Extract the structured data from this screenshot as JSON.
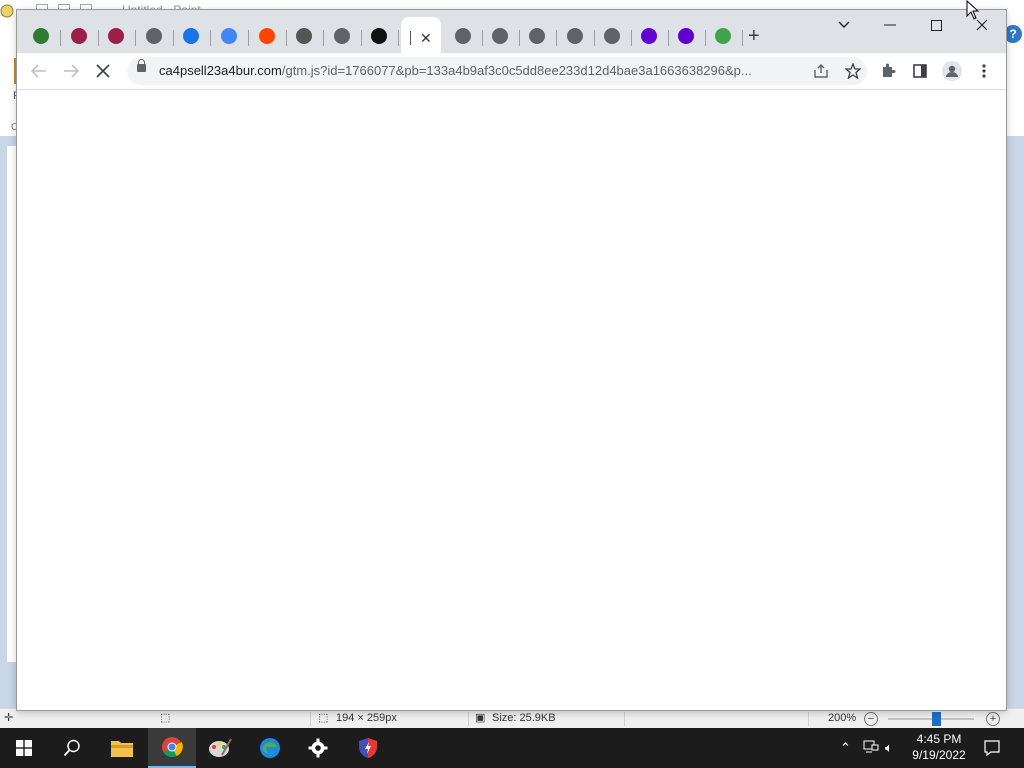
{
  "paint": {
    "title": "Untitled - Paint",
    "help_label": "?",
    "side_label_1": "P",
    "side_label_2": "C",
    "status": {
      "canvas_size": "194 × 259px",
      "file_size": "Size: 25.9KB",
      "zoom": "200%",
      "zoom_out": "−",
      "zoom_in": "+"
    }
  },
  "browser": {
    "tabs": [
      {
        "icon": "bug-icon",
        "color": "#2f7d32"
      },
      {
        "icon": "no-entry-icon",
        "color": "#9c1f49"
      },
      {
        "icon": "no-entry-icon",
        "color": "#9c1f49"
      },
      {
        "icon": "globe-icon",
        "color": "#5f6368"
      },
      {
        "icon": "bookmark-icon",
        "color": "#1a73e8"
      },
      {
        "icon": "google-icon",
        "color": "#4285f4"
      },
      {
        "icon": "reddit-icon",
        "color": "#ff4500"
      },
      {
        "icon": "airplane-icon",
        "color": "#555555"
      },
      {
        "icon": "globe-icon",
        "color": "#5f6368"
      },
      {
        "icon": "shield-icon",
        "color": "#111111"
      }
    ],
    "tabs_right": [
      {
        "icon": "globe-icon",
        "color": "#5f6368"
      },
      {
        "icon": "globe-icon",
        "color": "#5f6368"
      },
      {
        "icon": "globe-icon",
        "color": "#5f6368"
      },
      {
        "icon": "globe-icon",
        "color": "#5f6368"
      },
      {
        "icon": "globe-icon",
        "color": "#5f6368"
      },
      {
        "icon": "yahoo-icon",
        "color": "#6001d2"
      },
      {
        "icon": "yahoo-icon",
        "color": "#6001d2"
      },
      {
        "icon": "user-icon",
        "color": "#3fa34d"
      }
    ],
    "active_tab": {
      "close_label": "✕"
    },
    "new_tab_label": "+",
    "window_controls": {
      "list": "⌄",
      "minimize": "—",
      "maximize": "☐",
      "close": "✕"
    },
    "url_host": "ca4psell23a4bur.com",
    "url_path": "/gtm.js?id=1766077&pb=133a4b9af3c0c5dd8ee233d12d4bae3a1663638296&p...",
    "loading": true
  },
  "taskbar": {
    "time": "4:45 PM",
    "date": "9/19/2022"
  }
}
